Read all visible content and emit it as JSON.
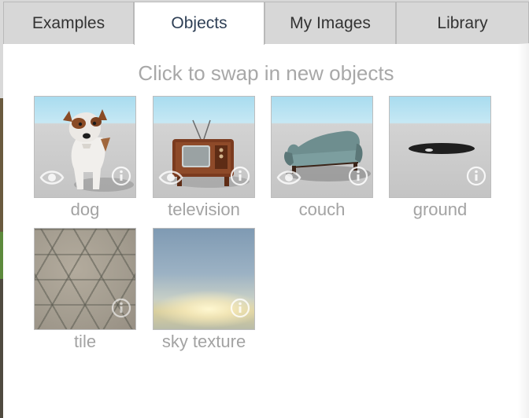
{
  "tabs": [
    {
      "label": "Examples",
      "active": false
    },
    {
      "label": "Objects",
      "active": true
    },
    {
      "label": "My Images",
      "active": false
    },
    {
      "label": "Library",
      "active": false
    }
  ],
  "hint": "Click to swap in new objects",
  "objects": [
    {
      "label": "dog",
      "icon": "dog-thumbnail",
      "has_eye": true
    },
    {
      "label": "television",
      "icon": "television-thumbnail",
      "has_eye": true
    },
    {
      "label": "couch",
      "icon": "couch-thumbnail",
      "has_eye": true
    },
    {
      "label": "ground",
      "icon": "ground-thumbnail",
      "has_eye": false
    },
    {
      "label": "tile",
      "icon": "tile-thumbnail",
      "has_eye": false
    },
    {
      "label": "sky texture",
      "icon": "sky-texture-thumbnail",
      "has_eye": false
    }
  ],
  "colors": {
    "tab_active_text": "#2e3f55",
    "tab_inactive_bg": "#d7d7d7",
    "caption": "#a3a3a3"
  }
}
